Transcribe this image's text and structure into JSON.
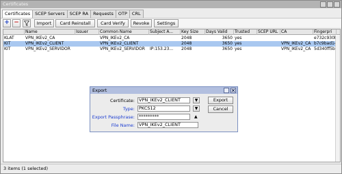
{
  "window": {
    "title": "Certificates"
  },
  "tabs": [
    "Certificates",
    "SCEP Servers",
    "SCEP RA",
    "Requests",
    "OTP",
    "CRL"
  ],
  "toolbar": {
    "add": "+",
    "remove": "−",
    "import": "Import",
    "card_reinstall": "Card Reinstall",
    "card_verify": "Card Verify",
    "revoke": "Revoke",
    "settings": "Settings"
  },
  "table": {
    "columns": [
      "",
      "Name",
      "Issuer",
      "Common Name",
      "Subject A...",
      "Key Size",
      "Days Valid",
      "Trusted",
      "SCEP URL",
      "CA",
      "Fingerpri"
    ],
    "rows": [
      {
        "flags": "KLAT",
        "name": "VPN_IKEv2_CA",
        "issuer": "",
        "common_name": "VPN_IKEv2_CA",
        "subject_alt": "",
        "key_size": "2048",
        "days_valid": "3650",
        "trusted": "yes",
        "scep_url": "",
        "ca": "",
        "fingerprint": "e732c930b..."
      },
      {
        "flags": "KIT",
        "name": "VPN_IKEv2_CLIENT",
        "issuer": "",
        "common_name": "VPN_IKEv2_CLIENT",
        "subject_alt": "",
        "key_size": "2048",
        "days_valid": "3650",
        "trusted": "yes",
        "scep_url": "",
        "ca": "VPN_IKEv2_CA",
        "fingerprint": "b7c9bad14..."
      },
      {
        "flags": "KIT",
        "name": "VPN_IKEv2_SERVIDOR",
        "issuer": "",
        "common_name": "VPN_IKEv2_SERVIDOR",
        "subject_alt": "IP:153.23...",
        "key_size": "2048",
        "days_valid": "3650",
        "trusted": "yes",
        "scep_url": "",
        "ca": "VPN_IKEv2_CA",
        "fingerprint": "5d340ff5b..."
      }
    ],
    "selected_row": 1
  },
  "status": {
    "text": "3 items (1 selected)"
  },
  "dialog": {
    "title": "Export",
    "certificate_label": "Certificate:",
    "certificate_value": "VPN_IKEv2_CLIENT",
    "type_label": "Type:",
    "type_value": "PKCS12",
    "passphrase_label": "Export Passphrase:",
    "passphrase_value": "*********",
    "filename_label": "File Name:",
    "filename_value": "VPN_IKEv2_CLIENT",
    "export_button": "Export",
    "cancel_button": "Cancel"
  },
  "colors": {
    "selected_row": "#a9c8f0",
    "dialog_title": "#b2bfdf",
    "link_label": "#1a3bd1"
  }
}
